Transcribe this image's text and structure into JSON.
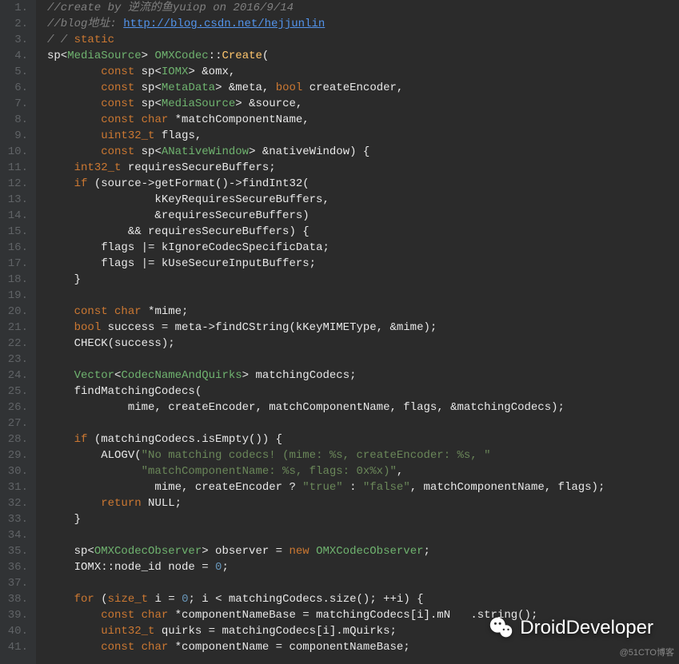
{
  "gutter": {
    "start": 1,
    "end": 41
  },
  "tokens": {
    "c1": "//create by 逆流的鱼yuiop on 2016/9/14",
    "c2a": "//blog地址: ",
    "c2b": "http://blog.csdn.net/hejjunlin",
    "c3a": "/ / ",
    "c3b": "static",
    "sp": "sp",
    "MediaSource": "MediaSource",
    "OMXCodec": "OMXCodec",
    "Create": "Create",
    "const": "const",
    "IOMX": "IOMX",
    "omx": "&omx,",
    "MetaData": "MetaData",
    "meta": "&meta, ",
    "bool": "bool",
    "createEncoder": "createEncoder,",
    "source": "&source,",
    "char": "char",
    "matchComponentName": "*matchComponentName,",
    "uint32_t": "uint32_t",
    "flags": "flags,",
    "ANativeWindow": "ANativeWindow",
    "nativeWindow": "&nativeWindow) {",
    "int32_t": "int32_t",
    "requiresSecureBuffers": "requiresSecureBuffers;",
    "if": "if",
    "l12b": "(source->getFormat()->findInt32(",
    "l13": "kKeyRequiresSecureBuffers,",
    "l14": "&requiresSecureBuffers)",
    "l15": "&& requiresSecureBuffers) {",
    "l16": "flags |= kIgnoreCodecSpecificData;",
    "l17": "flags |= kUseSecureInputBuffers;",
    "brace_close": "}",
    "mime": "*mime;",
    "l21a": "success = meta->findCString(kKeyMIMEType, &mime);",
    "l22": "CHECK(success);",
    "Vector": "Vector",
    "CodecNameAndQuirks": "CodecNameAndQuirks",
    "matchingCodecs": "matchingCodecs;",
    "l25": "findMatchingCodecs(",
    "l26": "mime, createEncoder, matchComponentName, flags, &matchingCodecs);",
    "l28b": "(matchingCodecs.isEmpty()) {",
    "l29a": "ALOGV(",
    "l29s": "\"No matching codecs! (mime: %s, createEncoder: %s, \"",
    "l30s": "\"matchComponentName: %s, flags: 0x%x)\"",
    "comma": ",",
    "l31a": "mime, createEncoder ? ",
    "true": "\"true\"",
    "colon": " : ",
    "false": "\"false\"",
    "l31b": ", matchComponentName, flags);",
    "return": "return",
    "NULL": "NULL;",
    "OMXCodecObserver": "OMXCodecObserver",
    "observer": "> observer = ",
    "new": "new",
    "OMXCodecObserver2": " OMXCodecObserver",
    "semicolon": ";",
    "l36a": "IOMX::node_id node = ",
    "zero": "0",
    "for": "for",
    "size_t": "size_t",
    "l38a": " i = ",
    "l38b": "; i < matchingCodecs.size(); ++i) {",
    "l39a": " *componentNameBase = matchingCodecs[i].mN",
    "l39b": ".string();",
    "l40a": " quirks = matchingCodecs[i].mQuirks;",
    "l41a": " *componentName = componentNameBase;"
  },
  "watermark_text": "DroidDeveloper",
  "credit": "@51CTO博客"
}
